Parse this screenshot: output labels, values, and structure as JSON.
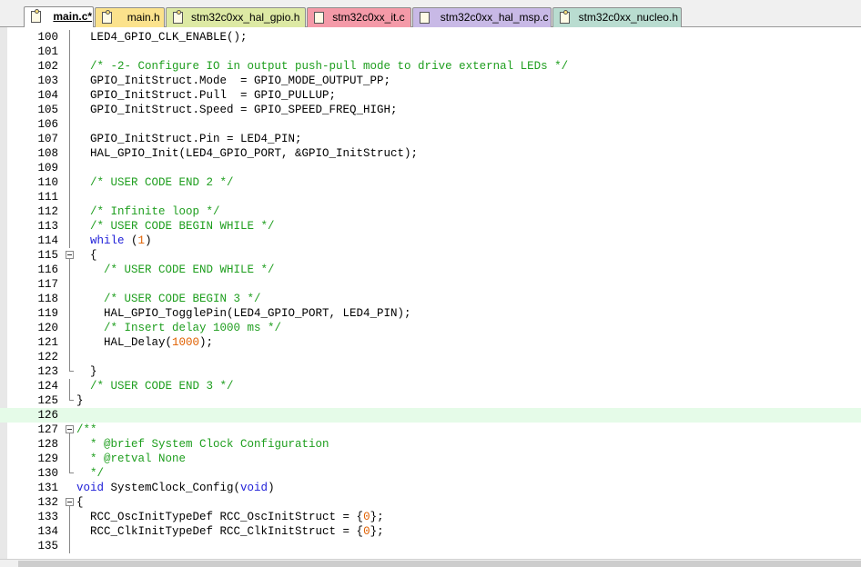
{
  "tabs": [
    {
      "label": "main.c*",
      "active": true,
      "color": "#ffffff",
      "icon": "c-file-modified-icon"
    },
    {
      "label": "main.h",
      "active": false,
      "color": "#fbe28c",
      "icon": "h-file-icon"
    },
    {
      "label": "stm32c0xx_hal_gpio.h",
      "active": false,
      "color": "#dde9a4",
      "icon": "h-file-icon"
    },
    {
      "label": "stm32c0xx_it.c",
      "active": false,
      "color": "#f49aa8",
      "icon": "c-file-icon"
    },
    {
      "label": "stm32c0xx_hal_msp.c",
      "active": false,
      "color": "#c8b9e6",
      "icon": "c-file-icon"
    },
    {
      "label": "stm32c0xx_nucleo.h",
      "active": false,
      "color": "#b9dcd0",
      "icon": "h-file-icon"
    }
  ],
  "colors": {
    "comment": "#1e9e1e",
    "keyword": "#2020d8",
    "number": "#e06000",
    "current_line": "#e5fbe8"
  },
  "editor": {
    "current_line": "126",
    "lines": [
      {
        "num": "100",
        "fold": "line",
        "tokens": [
          {
            "t": "  LED4_GPIO_CLK_ENABLE();",
            "c": "plain"
          }
        ]
      },
      {
        "num": "101",
        "fold": "line",
        "tokens": []
      },
      {
        "num": "102",
        "fold": "line",
        "tokens": [
          {
            "t": "  /* -2- Configure IO in output push-pull mode to drive external LEDs */",
            "c": "comment"
          }
        ]
      },
      {
        "num": "103",
        "fold": "line",
        "tokens": [
          {
            "t": "  GPIO_InitStruct.Mode  = GPIO_MODE_OUTPUT_PP;",
            "c": "plain"
          }
        ]
      },
      {
        "num": "104",
        "fold": "line",
        "tokens": [
          {
            "t": "  GPIO_InitStruct.Pull  = GPIO_PULLUP;",
            "c": "plain"
          }
        ]
      },
      {
        "num": "105",
        "fold": "line",
        "tokens": [
          {
            "t": "  GPIO_InitStruct.Speed = GPIO_SPEED_FREQ_HIGH;",
            "c": "plain"
          }
        ]
      },
      {
        "num": "106",
        "fold": "line",
        "tokens": []
      },
      {
        "num": "107",
        "fold": "line",
        "tokens": [
          {
            "t": "  GPIO_InitStruct.Pin = LED4_PIN;",
            "c": "plain"
          }
        ]
      },
      {
        "num": "108",
        "fold": "line",
        "tokens": [
          {
            "t": "  HAL_GPIO_Init(LED4_GPIO_PORT, &GPIO_InitStruct);",
            "c": "plain"
          }
        ]
      },
      {
        "num": "109",
        "fold": "line",
        "tokens": []
      },
      {
        "num": "110",
        "fold": "line",
        "tokens": [
          {
            "t": "  /* USER CODE END 2 */",
            "c": "comment"
          }
        ]
      },
      {
        "num": "111",
        "fold": "line",
        "tokens": []
      },
      {
        "num": "112",
        "fold": "line",
        "tokens": [
          {
            "t": "  /* Infinite loop */",
            "c": "comment"
          }
        ]
      },
      {
        "num": "113",
        "fold": "line",
        "tokens": [
          {
            "t": "  /* USER CODE BEGIN WHILE */",
            "c": "comment"
          }
        ]
      },
      {
        "num": "114",
        "fold": "line",
        "tokens": [
          {
            "t": "  ",
            "c": "plain"
          },
          {
            "t": "while",
            "c": "keyword"
          },
          {
            "t": " (",
            "c": "plain"
          },
          {
            "t": "1",
            "c": "number"
          },
          {
            "t": ")",
            "c": "plain"
          }
        ]
      },
      {
        "num": "115",
        "fold": "box",
        "tokens": [
          {
            "t": "  {",
            "c": "plain"
          }
        ]
      },
      {
        "num": "116",
        "fold": "line",
        "tokens": [
          {
            "t": "    /* USER CODE END WHILE */",
            "c": "comment"
          }
        ]
      },
      {
        "num": "117",
        "fold": "line",
        "tokens": []
      },
      {
        "num": "118",
        "fold": "line",
        "tokens": [
          {
            "t": "    /* USER CODE BEGIN 3 */",
            "c": "comment"
          }
        ]
      },
      {
        "num": "119",
        "fold": "line",
        "tokens": [
          {
            "t": "    HAL_GPIO_TogglePin(LED4_GPIO_PORT, LED4_PIN);",
            "c": "plain"
          }
        ]
      },
      {
        "num": "120",
        "fold": "line",
        "tokens": [
          {
            "t": "    /* Insert delay 1000 ms */",
            "c": "comment"
          }
        ]
      },
      {
        "num": "121",
        "fold": "line",
        "tokens": [
          {
            "t": "    HAL_Delay(",
            "c": "plain"
          },
          {
            "t": "1000",
            "c": "number"
          },
          {
            "t": ");",
            "c": "plain"
          }
        ]
      },
      {
        "num": "122",
        "fold": "line",
        "tokens": []
      },
      {
        "num": "123",
        "fold": "end",
        "tokens": [
          {
            "t": "  }",
            "c": "plain"
          }
        ]
      },
      {
        "num": "124",
        "fold": "line",
        "tokens": [
          {
            "t": "  /* USER CODE END 3 */",
            "c": "comment"
          }
        ]
      },
      {
        "num": "125",
        "fold": "end",
        "tokens": [
          {
            "t": "}",
            "c": "plain"
          }
        ]
      },
      {
        "num": "126",
        "fold": "none",
        "tokens": []
      },
      {
        "num": "127",
        "fold": "box",
        "tokens": [
          {
            "t": "/**",
            "c": "comment"
          }
        ]
      },
      {
        "num": "128",
        "fold": "line",
        "tokens": [
          {
            "t": "  * @brief System Clock Configuration",
            "c": "comment"
          }
        ]
      },
      {
        "num": "129",
        "fold": "line",
        "tokens": [
          {
            "t": "  * @retval None",
            "c": "comment"
          }
        ]
      },
      {
        "num": "130",
        "fold": "end",
        "tokens": [
          {
            "t": "  */",
            "c": "comment"
          }
        ]
      },
      {
        "num": "131",
        "fold": "none",
        "tokens": [
          {
            "t": "void",
            "c": "keyword"
          },
          {
            "t": " SystemClock_Config(",
            "c": "plain"
          },
          {
            "t": "void",
            "c": "keyword"
          },
          {
            "t": ")",
            "c": "plain"
          }
        ]
      },
      {
        "num": "132",
        "fold": "box",
        "tokens": [
          {
            "t": "{",
            "c": "plain"
          }
        ]
      },
      {
        "num": "133",
        "fold": "line",
        "tokens": [
          {
            "t": "  RCC_OscInitTypeDef RCC_OscInitStruct = {",
            "c": "plain"
          },
          {
            "t": "0",
            "c": "number"
          },
          {
            "t": "};",
            "c": "plain"
          }
        ]
      },
      {
        "num": "134",
        "fold": "line",
        "tokens": [
          {
            "t": "  RCC_ClkInitTypeDef RCC_ClkInitStruct = {",
            "c": "plain"
          },
          {
            "t": "0",
            "c": "number"
          },
          {
            "t": "};",
            "c": "plain"
          }
        ]
      },
      {
        "num": "135",
        "fold": "line",
        "tokens": []
      }
    ]
  }
}
